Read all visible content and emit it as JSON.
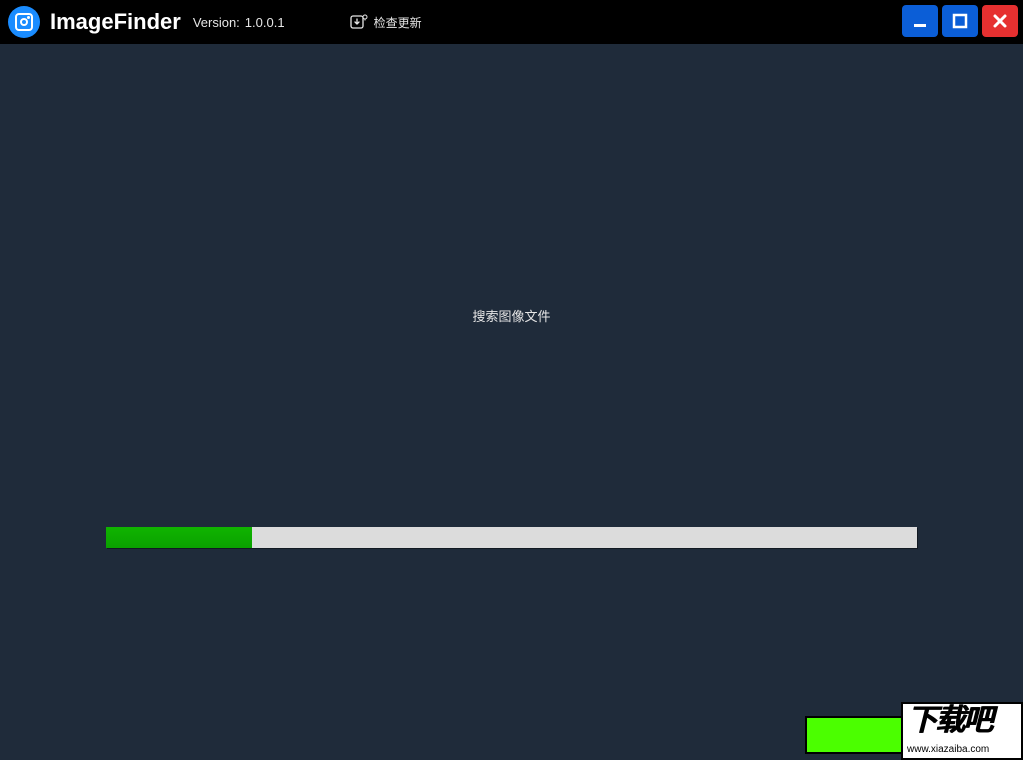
{
  "header": {
    "app_title": "ImageFinder",
    "version_label": "Version:",
    "version_value": "1.0.0.1",
    "check_update_label": "检查更新"
  },
  "main": {
    "status_text": "搜索图像文件",
    "progress_percent": 18
  },
  "watermark": {
    "big_text": "下载吧",
    "small_text": "www.xiazaiba.com"
  },
  "colors": {
    "titlebar_bg": "#000000",
    "content_bg": "#1f2b3a",
    "accent_blue": "#0b5ed7",
    "close_red": "#e63030",
    "progress_green": "#0aa100",
    "badge_green": "#4bff00"
  }
}
